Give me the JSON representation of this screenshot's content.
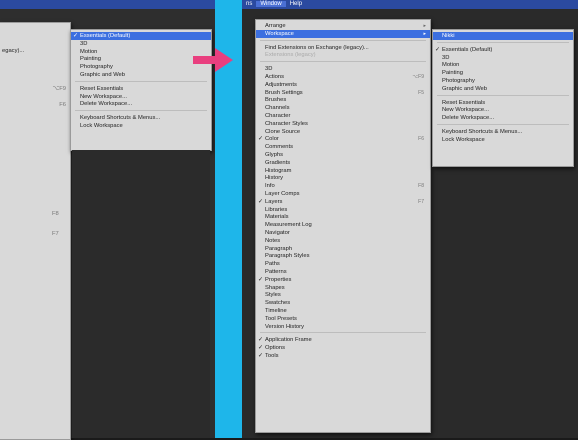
{
  "left": {
    "left_partial": [
      "egacy)..."
    ],
    "workspace_submenu": [
      {
        "label": "Essentials (Default)",
        "checked": true,
        "selected": true
      },
      {
        "label": "3D"
      },
      {
        "label": "Motion"
      },
      {
        "label": "Painting"
      },
      {
        "label": "Photography"
      },
      {
        "label": "Graphic and Web"
      },
      {
        "sep": true
      },
      {
        "label": "Reset Essentials"
      },
      {
        "label": "New Workspace..."
      },
      {
        "label": "Delete Workspace..."
      },
      {
        "sep": true
      },
      {
        "label": "Keyboard Shortcuts & Menus..."
      },
      {
        "label": "Lock Workspace"
      }
    ],
    "partial_shortcuts": [
      "⌥F9",
      "F6"
    ]
  },
  "right": {
    "menubar": [
      "ns",
      "Window",
      "Help"
    ],
    "window_menu": [
      {
        "label": "Arrange",
        "arrow": true
      },
      {
        "label": "Workspace",
        "arrow": true,
        "selected": true
      },
      {
        "sep": true
      },
      {
        "label": "Find Extensions on Exchange (legacy)..."
      },
      {
        "label": "Extensions (legacy)",
        "dim": true
      },
      {
        "sep": true
      },
      {
        "label": "3D"
      },
      {
        "label": "Actions",
        "shortcut": "⌥F9"
      },
      {
        "label": "Adjustments"
      },
      {
        "label": "Brush Settings",
        "shortcut": "F5"
      },
      {
        "label": "Brushes"
      },
      {
        "label": "Channels"
      },
      {
        "label": "Character"
      },
      {
        "label": "Character Styles"
      },
      {
        "label": "Clone Source"
      },
      {
        "label": "Color",
        "checked": true,
        "shortcut": "F6"
      },
      {
        "label": "Comments"
      },
      {
        "label": "Glyphs"
      },
      {
        "label": "Gradients"
      },
      {
        "label": "Histogram"
      },
      {
        "label": "History"
      },
      {
        "label": "Info",
        "shortcut": "F8"
      },
      {
        "label": "Layer Comps"
      },
      {
        "label": "Layers",
        "checked": true,
        "shortcut": "F7"
      },
      {
        "label": "Libraries"
      },
      {
        "label": "Materials"
      },
      {
        "label": "Measurement Log"
      },
      {
        "label": "Navigator"
      },
      {
        "label": "Notes"
      },
      {
        "label": "Paragraph"
      },
      {
        "label": "Paragraph Styles"
      },
      {
        "label": "Paths"
      },
      {
        "label": "Patterns"
      },
      {
        "label": "Properties",
        "checked": true
      },
      {
        "label": "Shapes"
      },
      {
        "label": "Styles"
      },
      {
        "label": "Swatches"
      },
      {
        "label": "Timeline"
      },
      {
        "label": "Tool Presets"
      },
      {
        "label": "Version History"
      },
      {
        "sep": true
      },
      {
        "label": "Application Frame",
        "checked": true
      },
      {
        "label": "Options",
        "checked": true
      },
      {
        "label": "Tools",
        "checked": true
      }
    ],
    "workspace_submenu": [
      {
        "label": "Nikki",
        "selected": true
      },
      {
        "sep": true
      },
      {
        "label": "Essentials (Default)",
        "checked": true
      },
      {
        "label": "3D"
      },
      {
        "label": "Motion"
      },
      {
        "label": "Painting"
      },
      {
        "label": "Photography"
      },
      {
        "label": "Graphic and Web"
      },
      {
        "sep": true
      },
      {
        "label": "Reset Essentials"
      },
      {
        "label": "New Workspace..."
      },
      {
        "label": "Delete Workspace..."
      },
      {
        "sep": true
      },
      {
        "label": "Keyboard Shortcuts & Menus..."
      },
      {
        "label": "Lock Workspace"
      }
    ]
  },
  "colors": {
    "divider": "#1eb6ea",
    "arrow": "#e93f7f",
    "menubar": "#2b4aa0",
    "selection": "#3c6fe0",
    "menu_bg": "#d9d9d9"
  },
  "icons": [
    "arrow-right-icon",
    "checkmark-icon",
    "submenu-arrow-icon"
  ]
}
